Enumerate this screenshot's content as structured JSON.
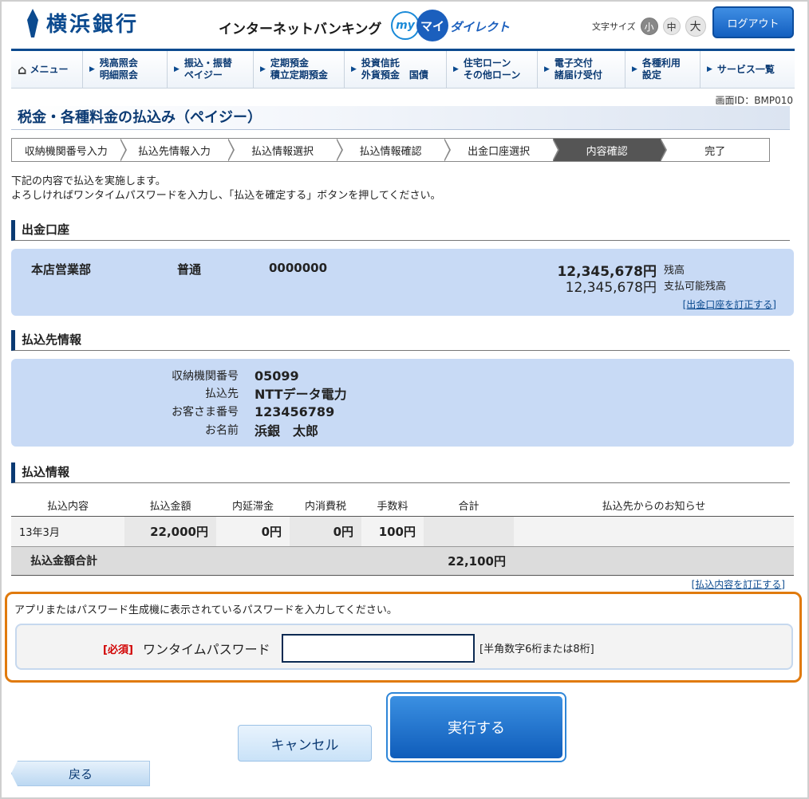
{
  "header": {
    "bank_name": "横浜銀行",
    "service_title": "インターネットバンキング",
    "my_label": "my",
    "mai_label": "マイ",
    "direct_label": "ダイレクト",
    "font_size_label": "文字サイズ",
    "font_sizes": [
      "小",
      "中",
      "大"
    ],
    "logout_label": "ログアウト"
  },
  "nav": {
    "items": [
      {
        "label": "メニュー"
      },
      {
        "label": "残高照会\n明細照会"
      },
      {
        "label": "振込・振替\nペイジー"
      },
      {
        "label": "定期預金\n積立定期預金"
      },
      {
        "label": "投資信託\n外貨預金　国債"
      },
      {
        "label": "住宅ローン\nその他ローン"
      },
      {
        "label": "電子交付\n諸届け受付"
      },
      {
        "label": "各種利用\n設定"
      },
      {
        "label": "サービス一覧"
      }
    ]
  },
  "page": {
    "screen_id": "画面ID：BMP010",
    "title": "税金・各種料金の払込み（ペイジー）",
    "steps": [
      "収納機関番号入力",
      "払込先情報入力",
      "払込情報選択",
      "払込情報確認",
      "出金口座選択",
      "内容確認",
      "完了"
    ],
    "active_step": 5,
    "intro_line1": "下記の内容で払込を実施します。",
    "intro_line2": "よろしければワンタイムパスワードを入力し、「払込を確定する」ボタンを押してください。"
  },
  "account": {
    "heading": "出金口座",
    "branch": "本店営業部",
    "type": "普通",
    "number": "0000000",
    "balance": "12,345,678円",
    "balance_label": "残高",
    "available": "12,345,678円",
    "available_label": "支払可能残高",
    "amend_link": "[出金口座を訂正する]"
  },
  "payee": {
    "heading": "払込先情報",
    "rows": [
      {
        "key": "収納機関番号",
        "value": "05099"
      },
      {
        "key": "払込先",
        "value": "NTTデータ電力"
      },
      {
        "key": "お客さま番号",
        "value": "123456789"
      },
      {
        "key": "お名前",
        "value": "浜銀　太郎"
      }
    ]
  },
  "payment": {
    "heading": "払込情報",
    "columns": [
      "払込内容",
      "払込金額",
      "内延滞金",
      "内消費税",
      "手数料",
      "合計",
      "払込先からのお知らせ"
    ],
    "row": {
      "content": "13年3月",
      "amount": "22,000円",
      "late_fee": "0円",
      "tax": "0円",
      "fee": "100円",
      "total": "",
      "notice": ""
    },
    "total_label": "払込金額合計",
    "total_value": "22,100円",
    "amend_link": "[払込内容を訂正する]"
  },
  "otp": {
    "message": "アプリまたはパスワード生成機に表示されているパスワードを入力してください。",
    "required": "[必須]",
    "label": "ワンタイムパスワード",
    "value": "",
    "hint": "[半角数字6桁または8桁]"
  },
  "actions": {
    "cancel": "キャンセル",
    "execute": "実行する",
    "back": "戻る"
  },
  "colors": {
    "brand": "#0b4a8f",
    "panel": "#c8daf5",
    "highlight_border": "#e07a0d",
    "required": "#d10000"
  }
}
